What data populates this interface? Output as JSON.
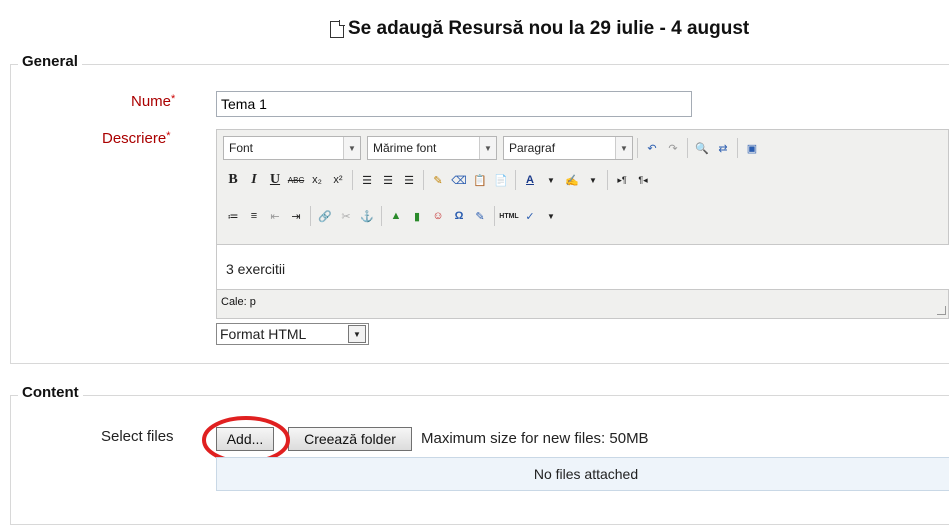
{
  "page_title": "Se adaugă Resursă nou la 29 iulie - 4 august",
  "general": {
    "legend": "General",
    "name_label": "Nume",
    "name_value": "Tema 1",
    "description_label": "Descriere",
    "required_mark": "*"
  },
  "editor": {
    "font_select": "Font",
    "size_select": "Mărime font",
    "para_select": "Paragraf",
    "content": "3 exercitii",
    "path_label": "Cale: p",
    "format_value": "Format HTML"
  },
  "content_section": {
    "legend": "Content",
    "select_files_label": "Select files",
    "add_button": "Add...",
    "create_folder_button": "Creează folder",
    "max_size_text": "Maximum size for new files: 50MB",
    "no_files_text": "No files attached"
  },
  "colors": {
    "required_label": "#aa0000",
    "highlight_circle": "#e02020",
    "dropzone_bg": "#eef4fa"
  }
}
